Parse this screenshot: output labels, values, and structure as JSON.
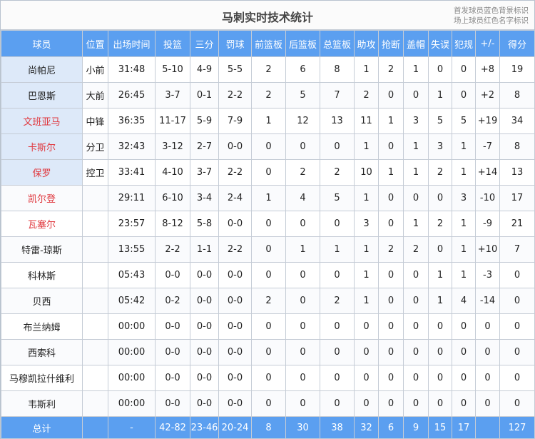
{
  "title": "马刺实时技术统计",
  "legend": [
    "首发球员蓝色背景标识",
    "场上球员红色名字标识"
  ],
  "colors": {
    "header_bg": "#5b9ff0",
    "starter_bg": "#dde9f9",
    "on_court_name": "#e0383e"
  },
  "headers": [
    "球员",
    "位置",
    "出场时间",
    "投篮",
    "三分",
    "罚球",
    "前篮板",
    "后篮板",
    "总篮板",
    "助攻",
    "抢断",
    "盖帽",
    "失误",
    "犯规",
    "+/-",
    "得分"
  ],
  "players": [
    {
      "name": "尚帕尼",
      "pos": "小前",
      "min": "31:48",
      "fg": "5-10",
      "tp": "4-9",
      "ft": "5-5",
      "oreb": "2",
      "dreb": "6",
      "reb": "8",
      "ast": "1",
      "stl": "2",
      "blk": "1",
      "tov": "0",
      "pf": "0",
      "pm": "+8",
      "pts": "19",
      "starter": true,
      "on_court": false
    },
    {
      "name": "巴恩斯",
      "pos": "大前",
      "min": "26:45",
      "fg": "3-7",
      "tp": "0-1",
      "ft": "2-2",
      "oreb": "2",
      "dreb": "5",
      "reb": "7",
      "ast": "2",
      "stl": "0",
      "blk": "0",
      "tov": "1",
      "pf": "0",
      "pm": "+2",
      "pts": "8",
      "starter": true,
      "on_court": false
    },
    {
      "name": "文班亚马",
      "pos": "中锋",
      "min": "36:35",
      "fg": "11-17",
      "tp": "5-9",
      "ft": "7-9",
      "oreb": "1",
      "dreb": "12",
      "reb": "13",
      "ast": "11",
      "stl": "1",
      "blk": "3",
      "tov": "5",
      "pf": "5",
      "pm": "+19",
      "pts": "34",
      "starter": true,
      "on_court": true
    },
    {
      "name": "卡斯尔",
      "pos": "分卫",
      "min": "32:43",
      "fg": "3-12",
      "tp": "2-7",
      "ft": "0-0",
      "oreb": "0",
      "dreb": "0",
      "reb": "0",
      "ast": "1",
      "stl": "0",
      "blk": "1",
      "tov": "3",
      "pf": "1",
      "pm": "-7",
      "pts": "8",
      "starter": true,
      "on_court": true
    },
    {
      "name": "保罗",
      "pos": "控卫",
      "min": "33:41",
      "fg": "4-10",
      "tp": "3-7",
      "ft": "2-2",
      "oreb": "0",
      "dreb": "2",
      "reb": "2",
      "ast": "10",
      "stl": "1",
      "blk": "1",
      "tov": "2",
      "pf": "1",
      "pm": "+14",
      "pts": "13",
      "starter": true,
      "on_court": true
    },
    {
      "name": "凯尔登",
      "pos": "",
      "min": "29:11",
      "fg": "6-10",
      "tp": "3-4",
      "ft": "2-4",
      "oreb": "1",
      "dreb": "4",
      "reb": "5",
      "ast": "1",
      "stl": "0",
      "blk": "0",
      "tov": "0",
      "pf": "3",
      "pm": "-10",
      "pts": "17",
      "starter": false,
      "on_court": true
    },
    {
      "name": "瓦塞尔",
      "pos": "",
      "min": "23:57",
      "fg": "8-12",
      "tp": "5-8",
      "ft": "0-0",
      "oreb": "0",
      "dreb": "0",
      "reb": "0",
      "ast": "3",
      "stl": "0",
      "blk": "1",
      "tov": "2",
      "pf": "1",
      "pm": "-9",
      "pts": "21",
      "starter": false,
      "on_court": true
    },
    {
      "name": "特雷-琼斯",
      "pos": "",
      "min": "13:55",
      "fg": "2-2",
      "tp": "1-1",
      "ft": "2-2",
      "oreb": "0",
      "dreb": "1",
      "reb": "1",
      "ast": "1",
      "stl": "2",
      "blk": "2",
      "tov": "0",
      "pf": "1",
      "pm": "+10",
      "pts": "7",
      "starter": false,
      "on_court": false
    },
    {
      "name": "科林斯",
      "pos": "",
      "min": "05:43",
      "fg": "0-0",
      "tp": "0-0",
      "ft": "0-0",
      "oreb": "0",
      "dreb": "0",
      "reb": "0",
      "ast": "1",
      "stl": "0",
      "blk": "0",
      "tov": "1",
      "pf": "1",
      "pm": "-3",
      "pts": "0",
      "starter": false,
      "on_court": false
    },
    {
      "name": "贝西",
      "pos": "",
      "min": "05:42",
      "fg": "0-2",
      "tp": "0-0",
      "ft": "0-0",
      "oreb": "2",
      "dreb": "0",
      "reb": "2",
      "ast": "1",
      "stl": "0",
      "blk": "0",
      "tov": "1",
      "pf": "4",
      "pm": "-14",
      "pts": "0",
      "starter": false,
      "on_court": false
    },
    {
      "name": "布兰纳姆",
      "pos": "",
      "min": "00:00",
      "fg": "0-0",
      "tp": "0-0",
      "ft": "0-0",
      "oreb": "0",
      "dreb": "0",
      "reb": "0",
      "ast": "0",
      "stl": "0",
      "blk": "0",
      "tov": "0",
      "pf": "0",
      "pm": "0",
      "pts": "0",
      "starter": false,
      "on_court": false
    },
    {
      "name": "西索科",
      "pos": "",
      "min": "00:00",
      "fg": "0-0",
      "tp": "0-0",
      "ft": "0-0",
      "oreb": "0",
      "dreb": "0",
      "reb": "0",
      "ast": "0",
      "stl": "0",
      "blk": "0",
      "tov": "0",
      "pf": "0",
      "pm": "0",
      "pts": "0",
      "starter": false,
      "on_court": false
    },
    {
      "name": "马穆凯拉什维利",
      "pos": "",
      "min": "00:00",
      "fg": "0-0",
      "tp": "0-0",
      "ft": "0-0",
      "oreb": "0",
      "dreb": "0",
      "reb": "0",
      "ast": "0",
      "stl": "0",
      "blk": "0",
      "tov": "0",
      "pf": "0",
      "pm": "0",
      "pts": "0",
      "starter": false,
      "on_court": false
    },
    {
      "name": "韦斯利",
      "pos": "",
      "min": "00:00",
      "fg": "0-0",
      "tp": "0-0",
      "ft": "0-0",
      "oreb": "0",
      "dreb": "0",
      "reb": "0",
      "ast": "0",
      "stl": "0",
      "blk": "0",
      "tov": "0",
      "pf": "0",
      "pm": "0",
      "pts": "0",
      "starter": false,
      "on_court": false
    }
  ],
  "totals": {
    "name": "总计",
    "pos": "",
    "min": "-",
    "fg": "42-82",
    "tp": "23-46",
    "ft": "20-24",
    "oreb": "8",
    "dreb": "30",
    "reb": "38",
    "ast": "32",
    "stl": "6",
    "blk": "9",
    "tov": "15",
    "pf": "17",
    "pm": "",
    "pts": "127"
  }
}
